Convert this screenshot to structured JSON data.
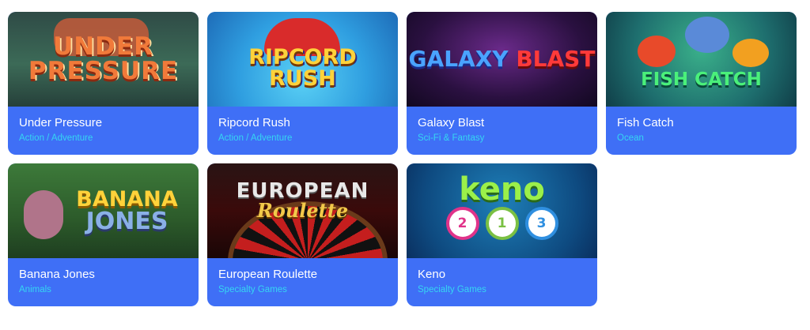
{
  "games": [
    {
      "title": "Under Pressure",
      "category": "Action / Adventure",
      "logo_lines": [
        "UNDER",
        "PRESSURE"
      ]
    },
    {
      "title": "Ripcord Rush",
      "category": "Action / Adventure",
      "logo_lines": [
        "RIPCORD",
        "RUSH"
      ]
    },
    {
      "title": "Galaxy Blast",
      "category": "Sci-Fi & Fantasy",
      "logo_lines": [
        "GALAXY",
        "BLAST"
      ]
    },
    {
      "title": "Fish Catch",
      "category": "Ocean",
      "logo_lines": [
        "FISH CATCH"
      ]
    },
    {
      "title": "Banana Jones",
      "category": "Animals",
      "logo_lines": [
        "BANANA",
        "JONES"
      ]
    },
    {
      "title": "European Roulette",
      "category": "Specialty Games",
      "logo_lines": [
        "EUROPEAN",
        "Roulette"
      ]
    },
    {
      "title": "Keno",
      "category": "Specialty Games",
      "logo_lines": [
        "keno"
      ],
      "balls": [
        "2",
        "1",
        "3"
      ]
    }
  ],
  "colors": {
    "card_background": "#3f6ff6",
    "title_text": "#ffffff",
    "category_text": "#35d6f2",
    "ball_colors": [
      "#e0338a",
      "#7ac043",
      "#2f8fe0"
    ]
  }
}
